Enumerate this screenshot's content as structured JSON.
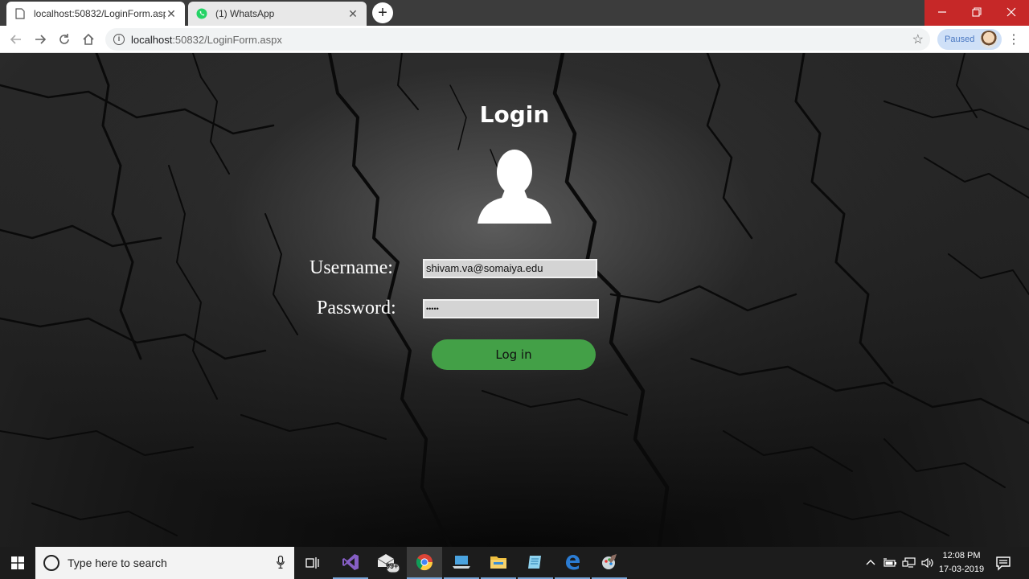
{
  "browser": {
    "tabs": [
      {
        "title": "localhost:50832/LoginForm.aspx",
        "active": true
      },
      {
        "title": "(1) WhatsApp",
        "active": false
      }
    ],
    "url_host": "localhost",
    "url_path": ":50832/LoginForm.aspx",
    "profile_status": "Paused"
  },
  "page": {
    "title": "Login",
    "username_label": "Username:",
    "username_value": "shivam.va@somaiya.edu",
    "password_label": "Password:",
    "password_value": "•••••",
    "login_button": "Log in"
  },
  "taskbar": {
    "search_placeholder": "Type here to search",
    "mail_badge": "99+",
    "time": "12:08 PM",
    "date": "17-03-2019"
  },
  "colors": {
    "login_button": "#43a047",
    "close_button": "#c62828",
    "profile_chip": "#cfe0f7"
  }
}
